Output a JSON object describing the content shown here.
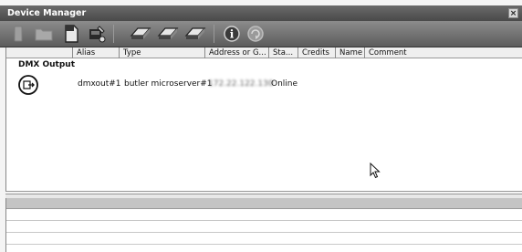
{
  "window": {
    "title": "Device Manager",
    "close_glyph": "×"
  },
  "toolbar": {
    "buttons": [
      {
        "icon": "remove-device-icon",
        "enabled": false
      },
      {
        "icon": "open-folder-icon",
        "enabled": false
      },
      {
        "icon": "new-document-icon",
        "enabled": true
      },
      {
        "icon": "configure-device-icon",
        "enabled": true
      },
      {
        "icon": "device-output-icon",
        "enabled": true
      },
      {
        "icon": "device-output-icon",
        "enabled": true
      },
      {
        "icon": "device-output-icon",
        "enabled": true
      },
      {
        "icon": "info-icon",
        "enabled": true
      },
      {
        "icon": "refresh-icon",
        "enabled": false
      }
    ]
  },
  "table": {
    "columns": [
      "Alias",
      "Type",
      "Address or G...",
      "Sta...",
      "Credits",
      "Name",
      "Comment"
    ],
    "group_label": "DMX Output",
    "rows": [
      {
        "alias": "dmxout#1",
        "type": "butler microserver#1",
        "address": "172.22.122.130",
        "status": "Online",
        "credits": "",
        "name": "",
        "comment": ""
      }
    ]
  },
  "colors": {
    "titlebar": "#555555",
    "toolbar": "#7a7a7a",
    "accent_circle": "#111111"
  }
}
